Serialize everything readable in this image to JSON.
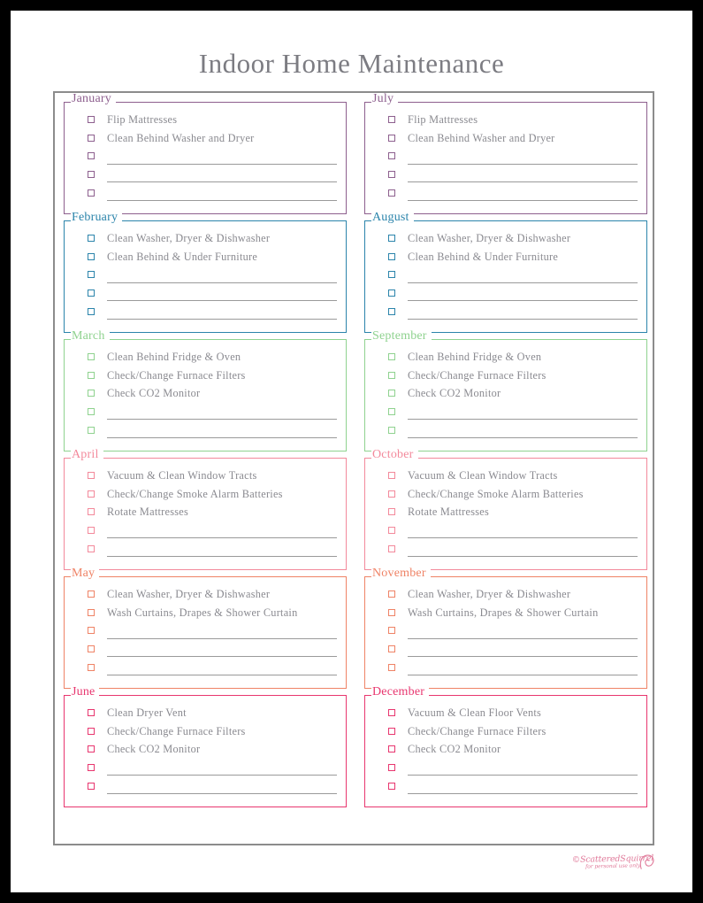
{
  "document": {
    "title": "Indoor Home Maintenance",
    "title_color": "#7c7c82",
    "frame_color": "#8c8c8c",
    "item_text_color": "#8a8a90",
    "rule_color": "#9a9a9a"
  },
  "watermark": {
    "main": "©ScatteredSquirrel",
    "sub": "for personal use only",
    "color": "#e07a9a",
    "icon": "squirrel-tail-icon"
  },
  "columns": [
    {
      "name": "left-column",
      "months": [
        {
          "name": "January",
          "color": "#8d5f8e",
          "items": [
            "Flip Mattresses",
            "Clean Behind Washer and Dryer"
          ],
          "blank_rows": 3
        },
        {
          "name": "February",
          "color": "#2b84ab",
          "items": [
            "Clean Washer, Dryer & Dishwasher",
            "Clean Behind & Under Furniture"
          ],
          "blank_rows": 3
        },
        {
          "name": "March",
          "color": "#8fd28f",
          "items": [
            "Clean Behind Fridge & Oven",
            "Check/Change Furnace Filters",
            "Check CO2 Monitor"
          ],
          "blank_rows": 2
        },
        {
          "name": "April",
          "color": "#f3899b",
          "items": [
            "Vacuum & Clean Window Tracts",
            "Check/Change Smoke Alarm Batteries",
            "Rotate Mattresses"
          ],
          "blank_rows": 2
        },
        {
          "name": "May",
          "color": "#ef8366",
          "items": [
            "Clean Washer, Dryer & Dishwasher",
            "Wash Curtains, Drapes & Shower Curtain"
          ],
          "blank_rows": 3
        },
        {
          "name": "June",
          "color": "#e8366f",
          "items": [
            "Clean Dryer Vent",
            "Check/Change Furnace Filters",
            "Check CO2 Monitor"
          ],
          "blank_rows": 2
        }
      ]
    },
    {
      "name": "right-column",
      "months": [
        {
          "name": "July",
          "color": "#8d5f8e",
          "items": [
            "Flip Mattresses",
            "Clean Behind Washer and Dryer"
          ],
          "blank_rows": 3
        },
        {
          "name": "August",
          "color": "#2b84ab",
          "items": [
            "Clean Washer, Dryer & Dishwasher",
            "Clean Behind & Under Furniture"
          ],
          "blank_rows": 3
        },
        {
          "name": "September",
          "color": "#8fd28f",
          "items": [
            "Clean Behind Fridge & Oven",
            "Check/Change Furnace Filters",
            "Check CO2 Monitor"
          ],
          "blank_rows": 2
        },
        {
          "name": "October",
          "color": "#f3899b",
          "items": [
            "Vacuum & Clean Window Tracts",
            "Check/Change Smoke Alarm Batteries",
            "Rotate Mattresses"
          ],
          "blank_rows": 2
        },
        {
          "name": "November",
          "color": "#ef8366",
          "items": [
            "Clean Washer, Dryer & Dishwasher",
            "Wash Curtains, Drapes & Shower Curtain"
          ],
          "blank_rows": 3
        },
        {
          "name": "December",
          "color": "#e8366f",
          "items": [
            "Vacuum & Clean Floor Vents",
            "Check/Change Furnace Filters",
            "Check CO2 Monitor"
          ],
          "blank_rows": 2
        }
      ]
    }
  ]
}
